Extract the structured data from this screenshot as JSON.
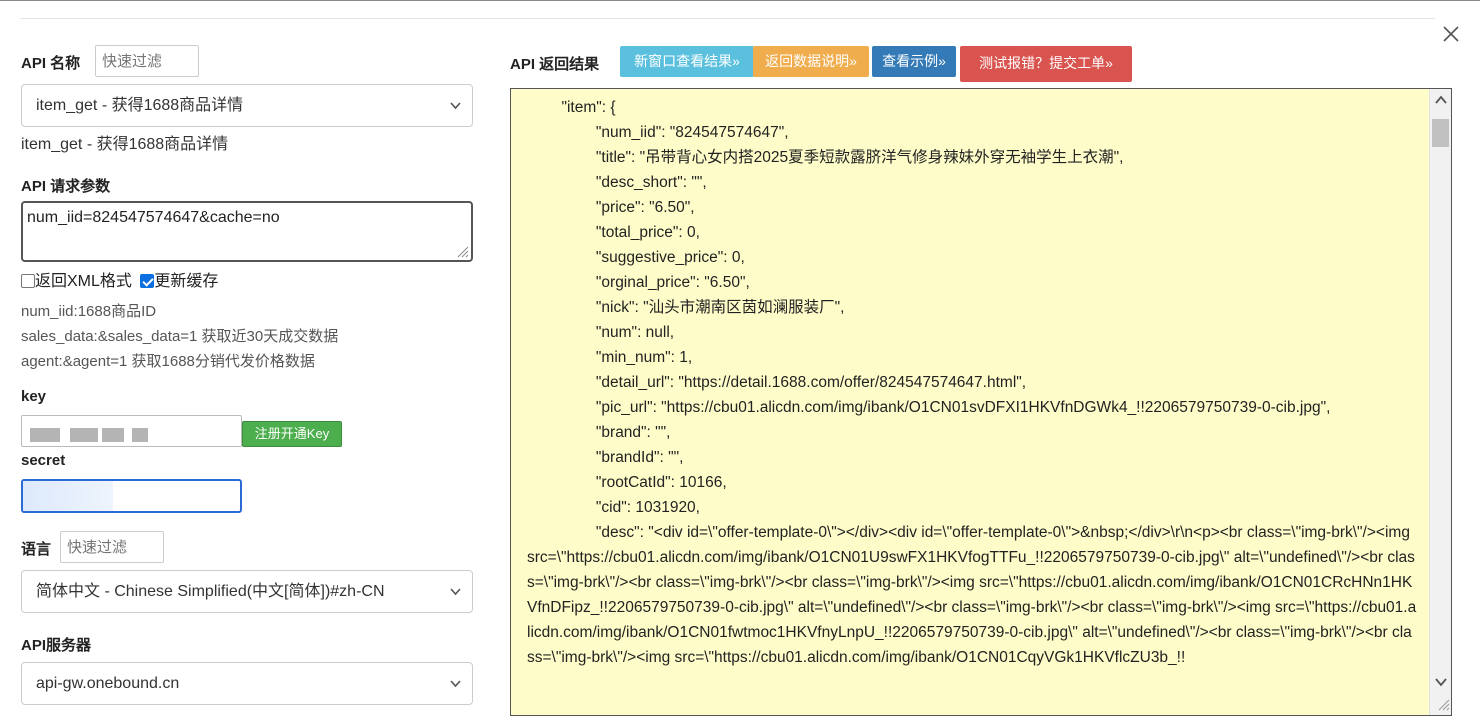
{
  "left": {
    "api_name_label": "API 名称",
    "api_name_filter_placeholder": "快速过滤",
    "api_select_value": "item_get - 获得1688商品详情",
    "api_description": "item_get - 获得1688商品详情",
    "params_label": "API 请求参数",
    "params_value": "num_iid=824547574647&cache=no",
    "xml_checkbox_label": "返回XML格式",
    "xml_checked": false,
    "cache_checkbox_label": "更新缓存",
    "cache_checked": true,
    "param_hints": [
      "num_iid:1688商品ID",
      "sales_data:&sales_data=1 获取近30天成交数据",
      "agent:&agent=1 获取1688分销代发价格数据"
    ],
    "key_label": "key",
    "key_value": "",
    "register_button": "注册开通Key",
    "secret_label": "secret",
    "secret_value": "",
    "language_label": "语言",
    "language_filter_placeholder": "快速过滤",
    "language_select_value": "简体中文 - Chinese Simplified(中文[简体])#zh-CN",
    "server_label": "API服务器",
    "server_select_value": "api-gw.onebound.cn"
  },
  "right": {
    "result_label": "API 返回结果",
    "buttons": {
      "new_window": "新窗口查看结果»",
      "return_doc": "返回数据说明»",
      "example": "查看示例»",
      "report": "测试报错？提交工单»"
    },
    "colors": {
      "new_window": "#5bc0de",
      "return_doc": "#f0ad4e",
      "example": "#337ab7",
      "report": "#d9534f",
      "result_bg": "#fefdc9"
    },
    "result_text": "        \"item\": {\n                \"num_iid\": \"824547574647\",\n                \"title\": \"吊带背心女内搭2025夏季短款露脐洋气修身辣妹外穿无袖学生上衣潮\",\n                \"desc_short\": \"\",\n                \"price\": \"6.50\",\n                \"total_price\": 0,\n                \"suggestive_price\": 0,\n                \"orginal_price\": \"6.50\",\n                \"nick\": \"汕头市潮南区茵如澜服装厂\",\n                \"num\": null,\n                \"min_num\": 1,\n                \"detail_url\": \"https://detail.1688.com/offer/824547574647.html\",\n                \"pic_url\": \"https://cbu01.alicdn.com/img/ibank/O1CN01svDFXI1HKVfnDGWk4_!!2206579750739-0-cib.jpg\",\n                \"brand\": \"\",\n                \"brandId\": \"\",\n                \"rootCatId\": 10166,\n                \"cid\": 1031920,\n                \"desc\": \"<div id=\\\"offer-template-0\\\"></div><div id=\\\"offer-template-0\\\">&nbsp;</div>\\r\\n<p><br class=\\\"img-brk\\\"/><img src=\\\"https://cbu01.alicdn.com/img/ibank/O1CN01U9swFX1HKVfogTTFu_!!2206579750739-0-cib.jpg\\\" alt=\\\"undefined\\\"/><br class=\\\"img-brk\\\"/><br class=\\\"img-brk\\\"/><br class=\\\"img-brk\\\"/><img src=\\\"https://cbu01.alicdn.com/img/ibank/O1CN01CRcHNn1HKVfnDFipz_!!2206579750739-0-cib.jpg\\\" alt=\\\"undefined\\\"/><br class=\\\"img-brk\\\"/><br class=\\\"img-brk\\\"/><img src=\\\"https://cbu01.alicdn.com/img/ibank/O1CN01fwtmoc1HKVfnyLnpU_!!2206579750739-0-cib.jpg\\\" alt=\\\"undefined\\\"/><br class=\\\"img-brk\\\"/><br class=\\\"img-brk\\\"/><img src=\\\"https://cbu01.alicdn.com/img/ibank/O1CN01CqyVGk1HKVflcZU3b_!!"
  }
}
